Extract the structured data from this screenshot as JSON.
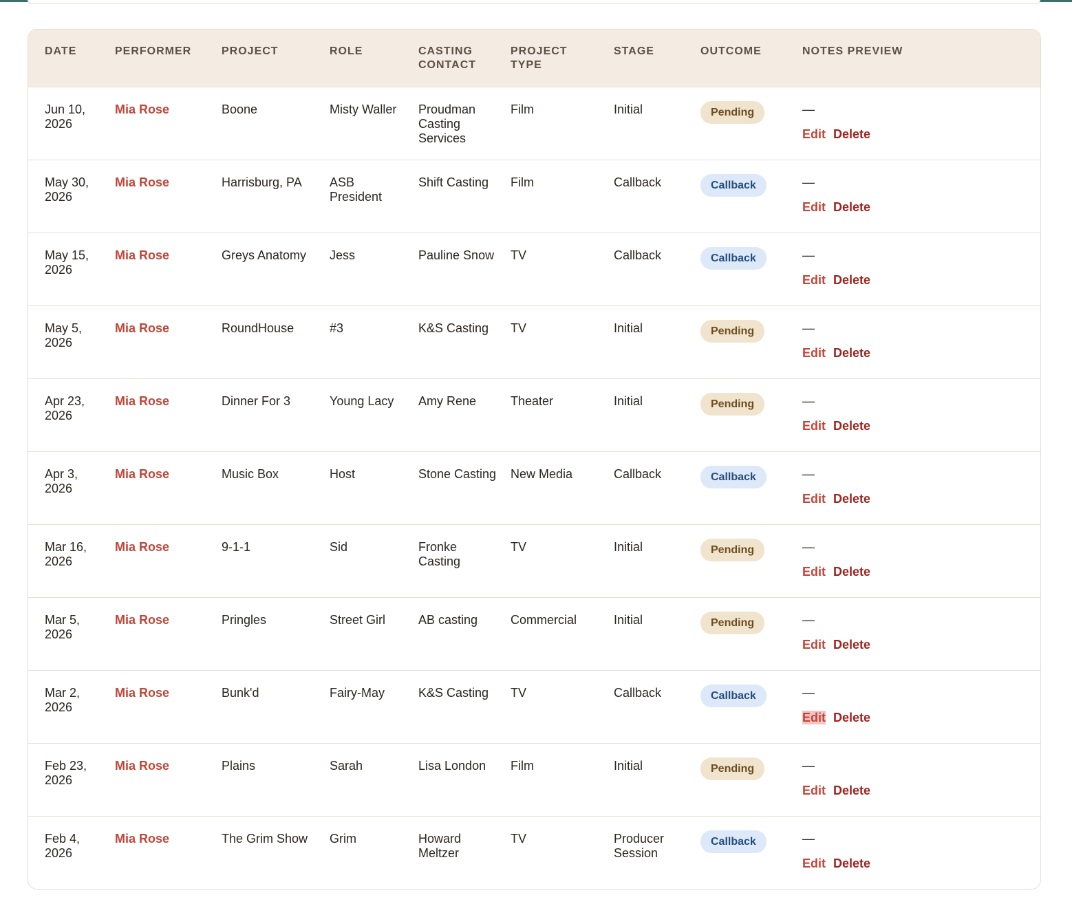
{
  "colors": {
    "accent": "#c0473a",
    "delete": "#9e2420",
    "header_bg": "#f4ece2",
    "pending_bg": "#f0e4cf",
    "callback_bg": "#dde9f8"
  },
  "table": {
    "headers": [
      "DATE",
      "PERFORMER",
      "PROJECT",
      "ROLE",
      "CASTING\nCONTACT",
      "PROJECT\nTYPE",
      "STAGE",
      "OUTCOME",
      "NOTES PREVIEW"
    ],
    "edit_label": "Edit",
    "delete_label": "Delete",
    "rows": [
      {
        "date": "Jun 10, 2026",
        "performer": "Mia Rose",
        "project": "Boone",
        "role": "Misty Waller",
        "contact": "Proudman Casting Services",
        "type": "Film",
        "stage": "Initial",
        "outcome": "Pending",
        "notes": "—"
      },
      {
        "date": "May 30, 2026",
        "performer": "Mia Rose",
        "project": "Harrisburg, PA",
        "role": "ASB President",
        "contact": "Shift Casting",
        "type": "Film",
        "stage": "Callback",
        "outcome": "Callback",
        "notes": "—"
      },
      {
        "date": "May 15, 2026",
        "performer": "Mia Rose",
        "project": "Greys Anatomy",
        "role": "Jess",
        "contact": "Pauline Snow",
        "type": "TV",
        "stage": "Callback",
        "outcome": "Callback",
        "notes": "—"
      },
      {
        "date": "May 5, 2026",
        "performer": "Mia Rose",
        "project": "RoundHouse",
        "role": "#3",
        "contact": "K&S Casting",
        "type": "TV",
        "stage": "Initial",
        "outcome": "Pending",
        "notes": "—"
      },
      {
        "date": "Apr 23, 2026",
        "performer": "Mia Rose",
        "project": "Dinner For 3",
        "role": "Young Lacy",
        "contact": "Amy Rene",
        "type": "Theater",
        "stage": "Initial",
        "outcome": "Pending",
        "notes": "—"
      },
      {
        "date": "Apr 3, 2026",
        "performer": "Mia Rose",
        "project": "Music Box",
        "role": "Host",
        "contact": "Stone Casting",
        "type": "New Media",
        "stage": "Callback",
        "outcome": "Callback",
        "notes": "—"
      },
      {
        "date": "Mar 16, 2026",
        "performer": "Mia Rose",
        "project": "9-1-1",
        "role": "Sid",
        "contact": "Fronke Casting",
        "type": "TV",
        "stage": "Initial",
        "outcome": "Pending",
        "notes": "—"
      },
      {
        "date": "Mar 5, 2026",
        "performer": "Mia Rose",
        "project": "Pringles",
        "role": "Street Girl",
        "contact": "AB casting",
        "type": "Commercial",
        "stage": "Initial",
        "outcome": "Pending",
        "notes": "—"
      },
      {
        "date": "Mar 2, 2026",
        "performer": "Mia Rose",
        "project": "Bunk'd",
        "role": "Fairy-May",
        "contact": "K&S Casting",
        "type": "TV",
        "stage": "Callback",
        "outcome": "Callback",
        "notes": "—",
        "edit_selected": true
      },
      {
        "date": "Feb 23, 2026",
        "performer": "Mia Rose",
        "project": "Plains",
        "role": "Sarah",
        "contact": "Lisa London",
        "type": "Film",
        "stage": "Initial",
        "outcome": "Pending",
        "notes": "—"
      },
      {
        "date": "Feb 4, 2026",
        "performer": "Mia Rose",
        "project": "The Grim Show",
        "role": "Grim",
        "contact": "Howard Meltzer",
        "type": "TV",
        "stage": "Producer Session",
        "outcome": "Callback",
        "notes": "—"
      }
    ]
  }
}
